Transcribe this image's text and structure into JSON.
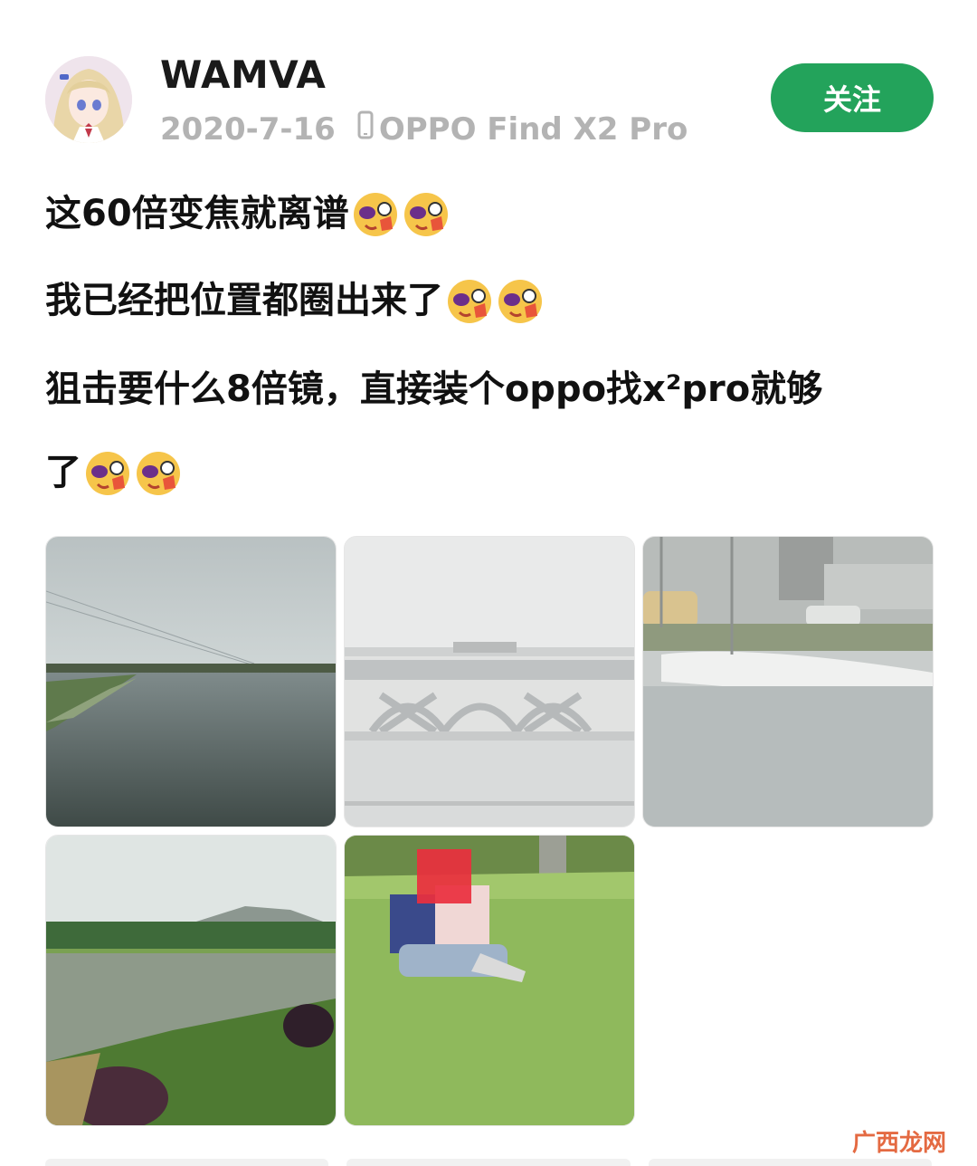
{
  "post": {
    "user": {
      "name": "WAMVA"
    },
    "date": "2020-7-16",
    "device": "OPPO Find X2 Pro",
    "follow_label": "关注",
    "lines": [
      "这60倍变焦就离谱",
      "我已经把位置都圈出来了",
      "狙击要什么8倍镜，直接装个oppo找x²pro就够",
      "了"
    ]
  },
  "images": [
    {
      "subject": "river-landscape"
    },
    {
      "subject": "distant-bridge-zoom"
    },
    {
      "subject": "riverside-zoom"
    },
    {
      "subject": "pond-landscape"
    },
    {
      "subject": "couple-on-grass"
    }
  ],
  "watermark": "广西龙网",
  "colors": {
    "accent": "#23a35b",
    "meta_text": "#b3b3b3",
    "watermark": "#e25a2e"
  }
}
